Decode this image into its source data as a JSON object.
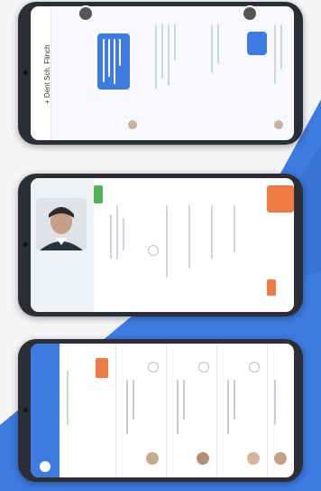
{
  "colors": {
    "background": "#f4f5f7",
    "accent_blue": "#3d7be0",
    "accent_orange": "#ef7a45",
    "accent_green": "#56b25a",
    "phone_frame": "#2b2f35"
  },
  "phones": [
    {
      "screen": "chat",
      "header_title": "+ Dent Sch. Flinch",
      "icons": [
        "back-icon",
        "avatar-icon"
      ]
    },
    {
      "screen": "doctor-profile",
      "icons": [
        "doctor-photo",
        "location-icon",
        "call-button-icon"
      ]
    },
    {
      "screen": "list",
      "icons": [
        "list-header-icon",
        "heart-icon"
      ]
    }
  ]
}
